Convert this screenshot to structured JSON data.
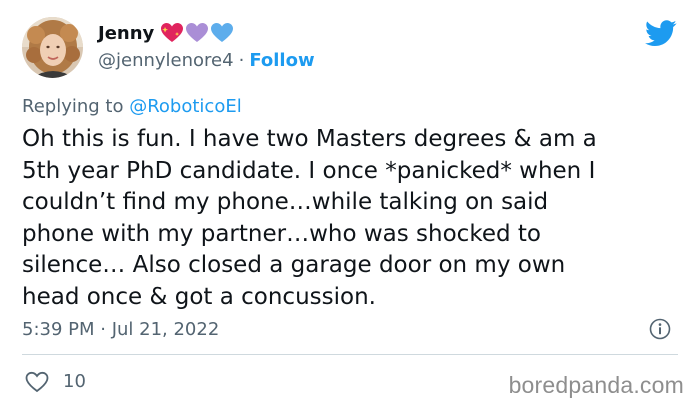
{
  "author": {
    "display_name": "Jenny",
    "handle": "@jennylenore4",
    "separator": "·",
    "follow_label": "Follow",
    "name_emojis": [
      "sparkling-heart-icon",
      "purple-heart-icon",
      "blue-heart-icon"
    ]
  },
  "reply": {
    "prefix": "Replying to",
    "mention": "@RoboticoEl"
  },
  "tweet": {
    "lines": [
      "Oh this is fun. I have two Masters degrees & am a",
      "5th year PhD candidate. I once *panicked* when I",
      "couldn’t find my phone…while talking on said",
      "phone with my partner…who was shocked to",
      "silence… Also closed a garage door on my own",
      "head once & got a concussion."
    ],
    "timestamp": "5:39 PM · Jul 21, 2022",
    "like_count": "10"
  },
  "watermark": "boredpanda.com",
  "colors": {
    "accent": "#1d9bf0",
    "text": "#0f1419",
    "secondary": "#536471",
    "divider": "#cfd9de"
  }
}
